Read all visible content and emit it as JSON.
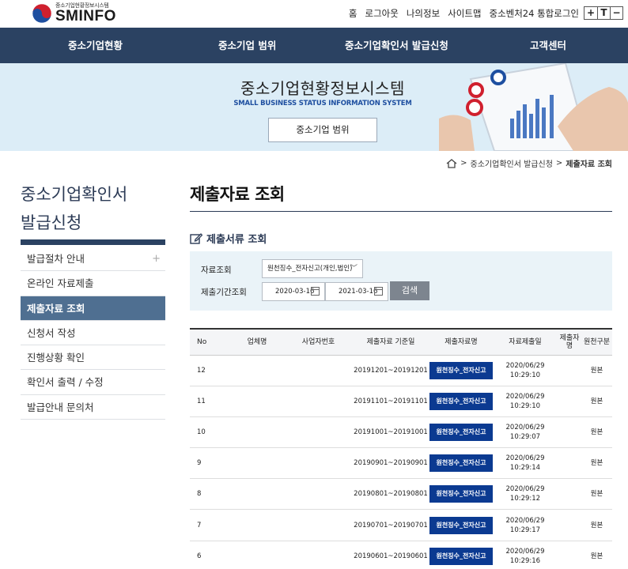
{
  "header": {
    "logo_small": "중소기업현황정보시스템",
    "logo_big": "SMINFO",
    "util_links": [
      "홈",
      "로그아웃",
      "나의정보",
      "사이트맵",
      "중소벤처24 통합로그인"
    ],
    "font_controls": [
      "+",
      "T",
      "−"
    ]
  },
  "gnb": [
    "중소기업현황",
    "중소기업 범위",
    "중소기업확인서 발급신청",
    "고객센터"
  ],
  "banner": {
    "title": "중소기업현황정보시스템",
    "subtitle": "SMALL BUSINESS STATUS INFORMATION SYSTEM",
    "button": "중소기업 범위"
  },
  "breadcrumb": {
    "items": [
      "중소기업확인서 발급신청"
    ],
    "current": "제출자료 조회",
    "sep": ">"
  },
  "sidebar": {
    "title_line1": "중소기업확인서",
    "title_line2": "발급신청",
    "items": [
      {
        "label": "발급절차 안내",
        "plus": "+"
      },
      {
        "label": "온라인 자료제출"
      },
      {
        "label": "제출자료 조회",
        "active": true
      },
      {
        "label": "신청서 작성"
      },
      {
        "label": "진행상황 확인"
      },
      {
        "label": "확인서 출력 / 수정"
      },
      {
        "label": "발급안내 문의처"
      }
    ]
  },
  "main": {
    "title": "제출자료 조회",
    "section_title": "제출서류 조회",
    "filter": {
      "type_label": "자료조회",
      "type_value": "원천징수_전자신고(개인,법인)",
      "period_label": "제출기간조회",
      "date_from": "2020-03-16",
      "date_to": "2021-03-16",
      "search_button": "검색"
    },
    "table": {
      "headers": [
        "No",
        "업체명",
        "사업자번호",
        "제출자료 기준일",
        "제출자료명",
        "자료제출일",
        "제출자\n명",
        "원천구분"
      ],
      "rows": [
        {
          "no": "12",
          "company": "",
          "bizno": "",
          "period": "20191201~20191201",
          "doc": "원천징수_전자신고",
          "date": "2020/06/29",
          "time": "10:29:10",
          "submitter": "",
          "type": "원본"
        },
        {
          "no": "11",
          "company": "",
          "bizno": "",
          "period": "20191101~20191101",
          "doc": "원천징수_전자신고",
          "date": "2020/06/29",
          "time": "10:29:10",
          "submitter": "",
          "type": "원본"
        },
        {
          "no": "10",
          "company": "",
          "bizno": "",
          "period": "20191001~20191001",
          "doc": "원천징수_전자신고",
          "date": "2020/06/29",
          "time": "10:29:07",
          "submitter": "",
          "type": "원본"
        },
        {
          "no": "9",
          "company": "",
          "bizno": "",
          "period": "20190901~20190901",
          "doc": "원천징수_전자신고",
          "date": "2020/06/29",
          "time": "10:29:14",
          "submitter": "",
          "type": "원본"
        },
        {
          "no": "8",
          "company": "",
          "bizno": "",
          "period": "20190801~20190801",
          "doc": "원천징수_전자신고",
          "date": "2020/06/29",
          "time": "10:29:12",
          "submitter": "",
          "type": "원본"
        },
        {
          "no": "7",
          "company": "",
          "bizno": "",
          "period": "20190701~20190701",
          "doc": "원천징수_전자신고",
          "date": "2020/06/29",
          "time": "10:29:17",
          "submitter": "",
          "type": "원본"
        },
        {
          "no": "6",
          "company": "",
          "bizno": "",
          "period": "20190601~20190601",
          "doc": "원천징수_전자신고",
          "date": "2020/06/29",
          "time": "10:29:16",
          "submitter": "",
          "type": "원본"
        }
      ]
    }
  },
  "colors": {
    "gnb": "#2b4262",
    "banner_bg": "#dcedf7",
    "active_nav": "#4f6f91",
    "doc_button": "#0b3a91"
  }
}
